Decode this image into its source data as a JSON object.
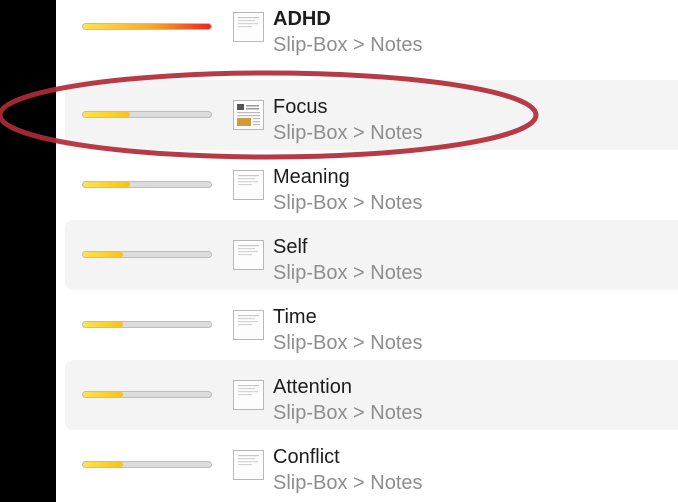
{
  "results": [
    {
      "title": "ADHD",
      "path": "Slip-Box > Notes",
      "relevance": 1.0,
      "bar_color": "red-gradient",
      "icon": "document-icon",
      "selected": false,
      "bold": true
    },
    {
      "title": "Focus",
      "path": "Slip-Box > Notes",
      "relevance": 0.37,
      "bar_color": "yellow-gradient",
      "icon": "image-document-icon",
      "selected": false,
      "bold": false
    },
    {
      "title": "Meaning",
      "path": "Slip-Box > Notes",
      "relevance": 0.37,
      "bar_color": "yellow-gradient",
      "icon": "document-icon",
      "selected": false,
      "bold": false
    },
    {
      "title": "Self",
      "path": "Slip-Box > Notes",
      "relevance": 0.31,
      "bar_color": "yellow-gradient",
      "icon": "document-icon",
      "selected": false,
      "bold": false
    },
    {
      "title": "Time",
      "path": "Slip-Box > Notes",
      "relevance": 0.31,
      "bar_color": "yellow-gradient",
      "icon": "document-icon",
      "selected": false,
      "bold": false
    },
    {
      "title": "Attention",
      "path": "Slip-Box > Notes",
      "relevance": 0.31,
      "bar_color": "yellow-gradient",
      "icon": "document-icon",
      "selected": false,
      "bold": false
    },
    {
      "title": "Conflict",
      "path": "Slip-Box > Notes",
      "relevance": 0.31,
      "bar_color": "yellow-gradient",
      "icon": "document-icon",
      "selected": false,
      "bold": false
    }
  ],
  "colors": {
    "annotation_ring": "#b12a36",
    "bar_track": "#dcdcdc",
    "bar_yellow_start": "#ffe34d",
    "bar_yellow_end": "#f6c21a",
    "bar_red_end": "#e8231f"
  }
}
